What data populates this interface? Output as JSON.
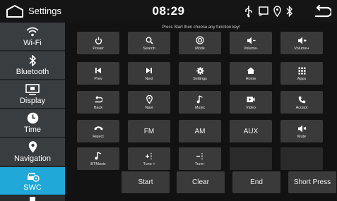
{
  "statusbar": {
    "title": "Settings",
    "time": "08:29"
  },
  "sidebar": {
    "items": [
      {
        "label": "Wi-Fi",
        "icon": "wifi-icon"
      },
      {
        "label": "Bluetooth",
        "icon": "bluetooth-icon"
      },
      {
        "label": "Display",
        "icon": "display-icon"
      },
      {
        "label": "Time",
        "icon": "clock-icon"
      },
      {
        "label": "Navigation",
        "icon": "location-pin-icon"
      },
      {
        "label": "SWC",
        "icon": "steering-wheel-car-icon",
        "active": true
      }
    ]
  },
  "main": {
    "hint": "Press Start then choose any function key!",
    "functions": [
      {
        "label": "Power",
        "icon": "power-icon"
      },
      {
        "label": "Search",
        "icon": "search-icon"
      },
      {
        "label": "Mode",
        "icon": "mode-icon"
      },
      {
        "label": "Volume-",
        "icon": "volume-down-icon"
      },
      {
        "label": "Volume+",
        "icon": "volume-up-icon"
      },
      {
        "label": "Prev",
        "icon": "previous-icon"
      },
      {
        "label": "Next",
        "icon": "next-icon"
      },
      {
        "label": "Settings",
        "icon": "gear-icon"
      },
      {
        "label": "Home",
        "icon": "home-icon"
      },
      {
        "label": "Apps",
        "icon": "apps-grid-icon"
      },
      {
        "label": "Back",
        "icon": "back-arrow-icon"
      },
      {
        "label": "Navi",
        "icon": "location-pin-icon"
      },
      {
        "label": "Music",
        "icon": "music-note-icon"
      },
      {
        "label": "Video",
        "icon": "video-camera-icon"
      },
      {
        "label": "Accept",
        "icon": "phone-accept-icon"
      },
      {
        "label": "Reject",
        "icon": "phone-reject-icon"
      },
      {
        "label": "FM"
      },
      {
        "label": "AM"
      },
      {
        "label": "AUX"
      },
      {
        "label": "Mute",
        "icon": "mute-icon"
      },
      {
        "label": "BTMusic",
        "icon": "bt-music-icon"
      },
      {
        "label": "Tune +",
        "icon": "tune-up-icon"
      },
      {
        "label": "Tune-",
        "icon": "tune-down-icon"
      }
    ],
    "actions": {
      "start": "Start",
      "clear": "Clear",
      "end": "End",
      "short_press": "Short Press"
    }
  },
  "colors": {
    "accent": "#1fa8d8",
    "sidebar_bg": "#3a3d40",
    "button_bg": "#3a3a3a"
  }
}
